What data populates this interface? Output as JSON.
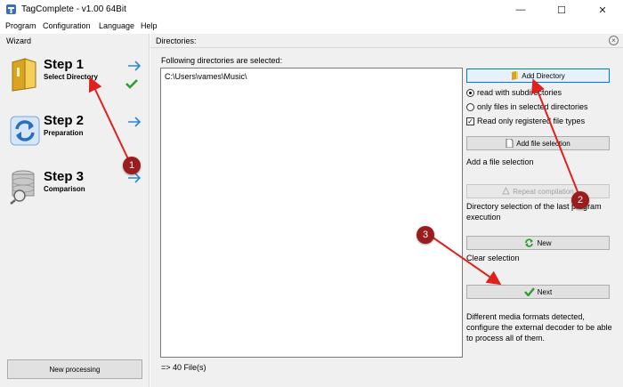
{
  "window": {
    "title": "TagComplete - v1.00 64Bit",
    "minimize": "—",
    "maximize": "☐",
    "close": "✕"
  },
  "menu": [
    "Program",
    "Configuration",
    "Language",
    "Help"
  ],
  "wizard": {
    "label": "Wizard",
    "steps": [
      {
        "title": "Step 1",
        "subtitle": "Select Directory",
        "completed": true
      },
      {
        "title": "Step 2",
        "subtitle": "Preparation"
      },
      {
        "title": "Step 3",
        "subtitle": "Comparison"
      }
    ],
    "new_processing": "New processing"
  },
  "directories": {
    "label": "Directories:",
    "list_label": "Following directories are selected:",
    "entries": [
      "C:\\Users\\vames\\Music\\"
    ],
    "count": "=> 40 File(s)"
  },
  "actions": {
    "add_directory": "Add Directory",
    "read_subdirs": "read with subdirectories",
    "only_files": "only files in selected directories",
    "read_registered": "Read only registered file types",
    "add_file_selection": "Add file selection",
    "add_file_desc": "Add a file selection",
    "repeat_compilation": "Repeat compilation",
    "repeat_desc": "Directory selection of the last program execution",
    "new": "New",
    "clear_desc": "Clear selection",
    "next": "Next",
    "formats_desc": "Different media formats detected, configure the external decoder to be able to process all of them."
  },
  "annotations": [
    "1",
    "2",
    "3"
  ],
  "colors": {
    "accent": "#0078d7",
    "annotation": "#9b1c1c",
    "arrow": "#e0201c",
    "check": "#2e9e2e"
  }
}
